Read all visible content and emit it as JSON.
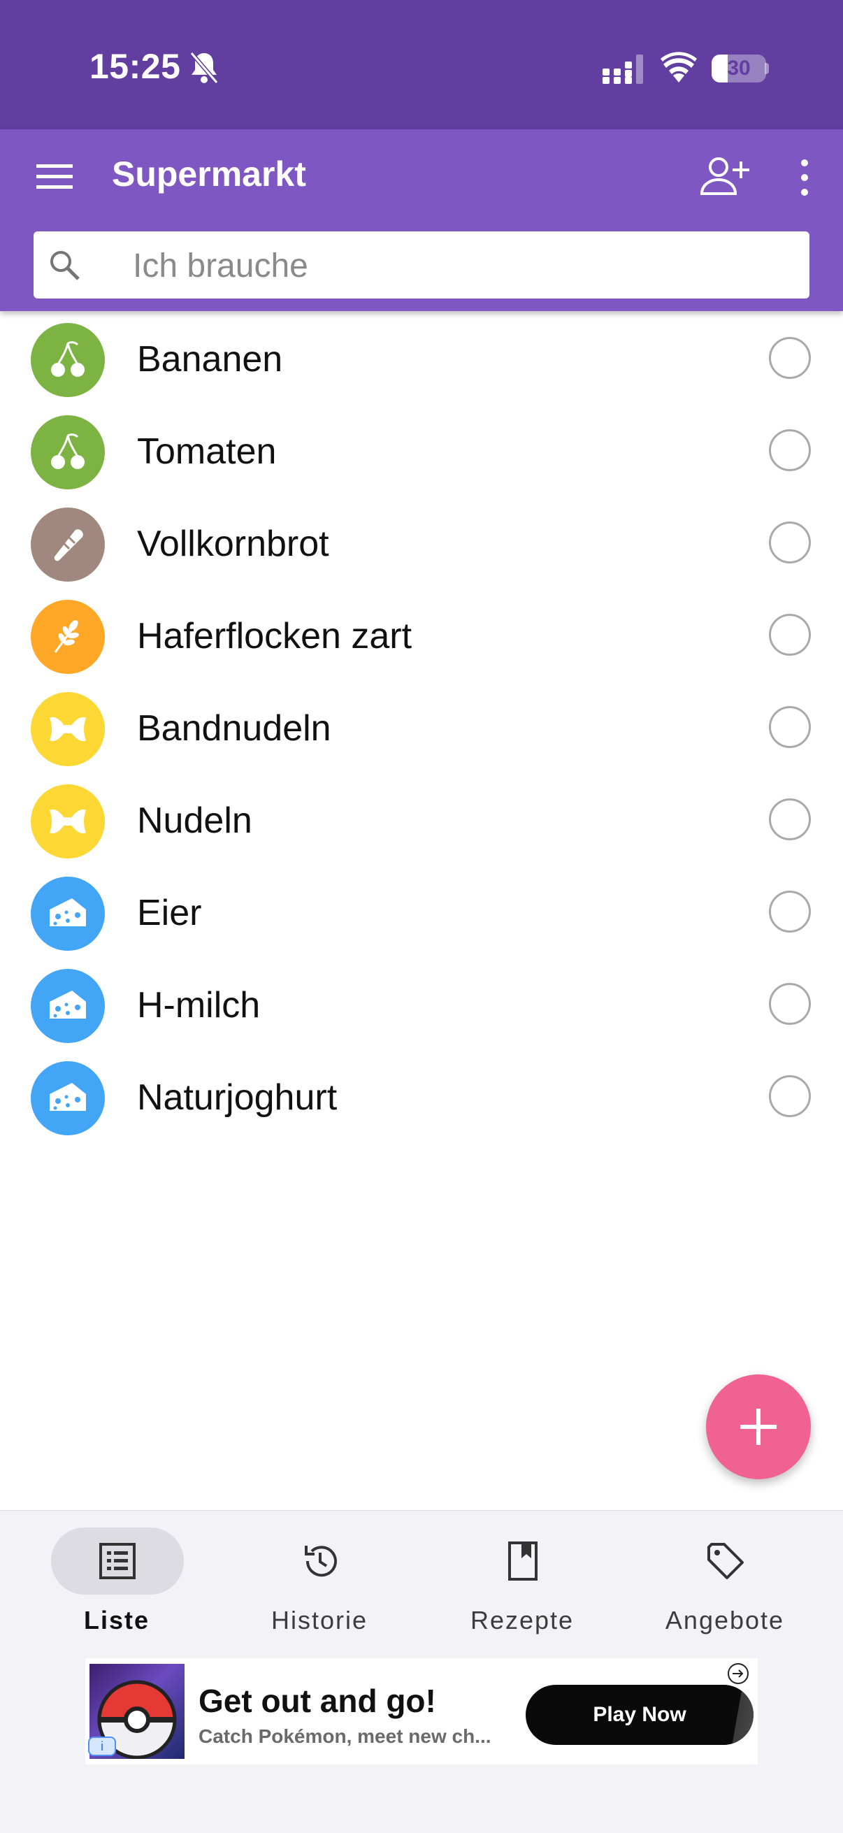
{
  "status_bar": {
    "time": "15:25",
    "battery": "30",
    "battery_level": 0.3,
    "icons": [
      "bell-muted-icon",
      "signal-icon",
      "wifi-icon",
      "battery-icon"
    ]
  },
  "app_bar": {
    "title": "Supermarkt",
    "icons": [
      "menu-icon",
      "add-person-icon",
      "more-vert-icon"
    ],
    "search_placeholder": "Ich brauche",
    "search_value": ""
  },
  "items": [
    {
      "label": "Bananen",
      "category_color": "#7cb342",
      "icon": "cherry-icon"
    },
    {
      "label": "Tomaten",
      "category_color": "#7cb342",
      "icon": "cherry-icon"
    },
    {
      "label": "Vollkornbrot",
      "category_color": "#a1887f",
      "icon": "bread-icon"
    },
    {
      "label": "Haferflocken zart",
      "category_color": "#ffa726",
      "icon": "grain-icon"
    },
    {
      "label": "Bandnudeln",
      "category_color": "#fdd835",
      "icon": "pasta-icon"
    },
    {
      "label": "Nudeln",
      "category_color": "#fdd835",
      "icon": "pasta-icon"
    },
    {
      "label": "Eier",
      "category_color": "#42a5f5",
      "icon": "cheese-icon"
    },
    {
      "label": "H-milch",
      "category_color": "#42a5f5",
      "icon": "cheese-icon"
    },
    {
      "label": "Naturjoghurt",
      "category_color": "#42a5f5",
      "icon": "cheese-icon"
    }
  ],
  "fab": {
    "icon": "plus-icon",
    "color": "#f06292"
  },
  "bottom_nav": {
    "active": "Liste",
    "items": [
      {
        "label": "Liste",
        "icon": "list-icon"
      },
      {
        "label": "Historie",
        "icon": "history-icon"
      },
      {
        "label": "Rezepte",
        "icon": "bookmark-icon"
      },
      {
        "label": "Angebote",
        "icon": "tag-icon"
      }
    ]
  },
  "ad": {
    "title": "Get out and go!",
    "subtitle": "Catch Pokémon, meet new ch...",
    "button": "Play Now",
    "info_icon": "info-icon",
    "arrow_icon": "arrow-right-circle-icon"
  },
  "colors": {
    "status_bar": "#613ea0",
    "app_bar": "#7e57c2",
    "nav_background": "#f3f3f7"
  }
}
